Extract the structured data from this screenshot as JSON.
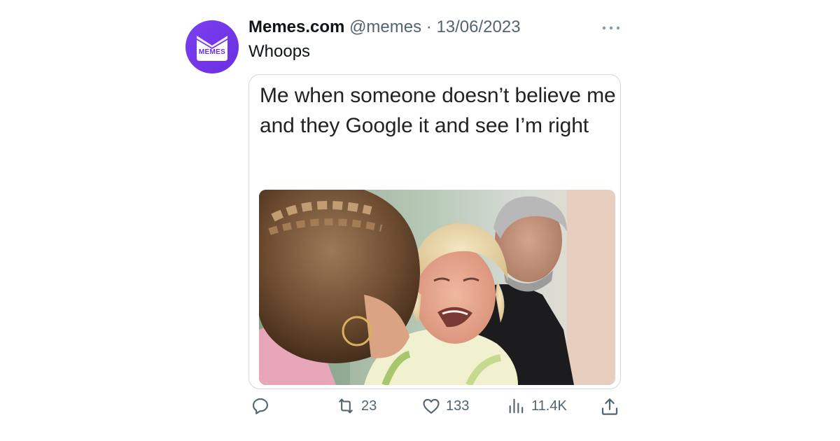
{
  "account": {
    "display_name": "Memes.com",
    "handle": "@memes",
    "separator": "·",
    "date": "13/06/2023",
    "avatar_text": "MEMES",
    "avatar_color": "#6a2fe0"
  },
  "tweet": {
    "text": "Whoops",
    "more_icon": "more-horizontal-icon"
  },
  "media": {
    "caption": "Me when someone doesn’t believe me and they Google it and see I’m right"
  },
  "actions": {
    "reply": {
      "icon": "reply-icon",
      "count": ""
    },
    "retweet": {
      "icon": "retweet-icon",
      "count": "23"
    },
    "like": {
      "icon": "heart-icon",
      "count": "133"
    },
    "views": {
      "icon": "views-icon",
      "count": "11.4K"
    },
    "share": {
      "icon": "share-icon"
    }
  },
  "colors": {
    "text_primary": "#0f1419",
    "text_secondary": "#536471",
    "border": "#cfd9de"
  }
}
